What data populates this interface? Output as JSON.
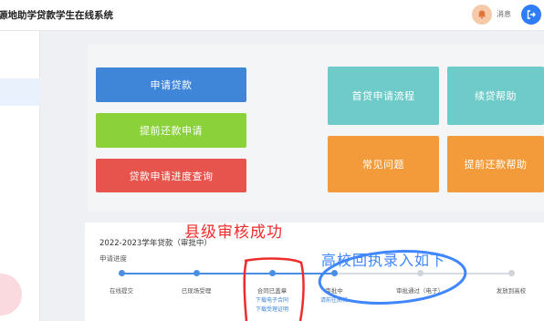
{
  "header": {
    "app_title": "源地助学贷款学生在线系统",
    "message_label": "消息"
  },
  "cards": {
    "apply_loan": "申请贷款",
    "early_repay_apply": "提前还款申请",
    "loan_progress_query": "贷款申请进度查询",
    "first_loan_flow": "首贷申请流程",
    "renew_help": "续贷帮助",
    "faq": "常见问题",
    "early_repay_help": "提前还款帮助"
  },
  "progress": {
    "loan_title": "2022-2023学年贷款（审批中）",
    "section_label": "申请进度",
    "steps": [
      {
        "label": "在线提交",
        "sub": [],
        "status": "done"
      },
      {
        "label": "已现场受理",
        "sub": [],
        "status": "done"
      },
      {
        "label": "合同已盖章",
        "sub": [
          "下载电子合同",
          "下载受理证明"
        ],
        "status": "done"
      },
      {
        "label": "审批中",
        "sub": [
          "请前往高校"
        ],
        "status": "done"
      },
      {
        "label": "审批通过（电子）",
        "sub": [],
        "status": "todo"
      },
      {
        "label": "发放到高校",
        "sub": [],
        "status": "todo"
      }
    ]
  },
  "annotations": {
    "county_review": "县级审核成功",
    "college_receipt": "高校回执录入如下"
  },
  "colors": {
    "blue": "#3f86d8",
    "green": "#8bd13a",
    "red": "#e6544d",
    "teal": "#6fcbc9",
    "orange": "#f39b3a",
    "annotation_red": "#ef2c2c",
    "annotation_blue": "#3f86ff"
  }
}
